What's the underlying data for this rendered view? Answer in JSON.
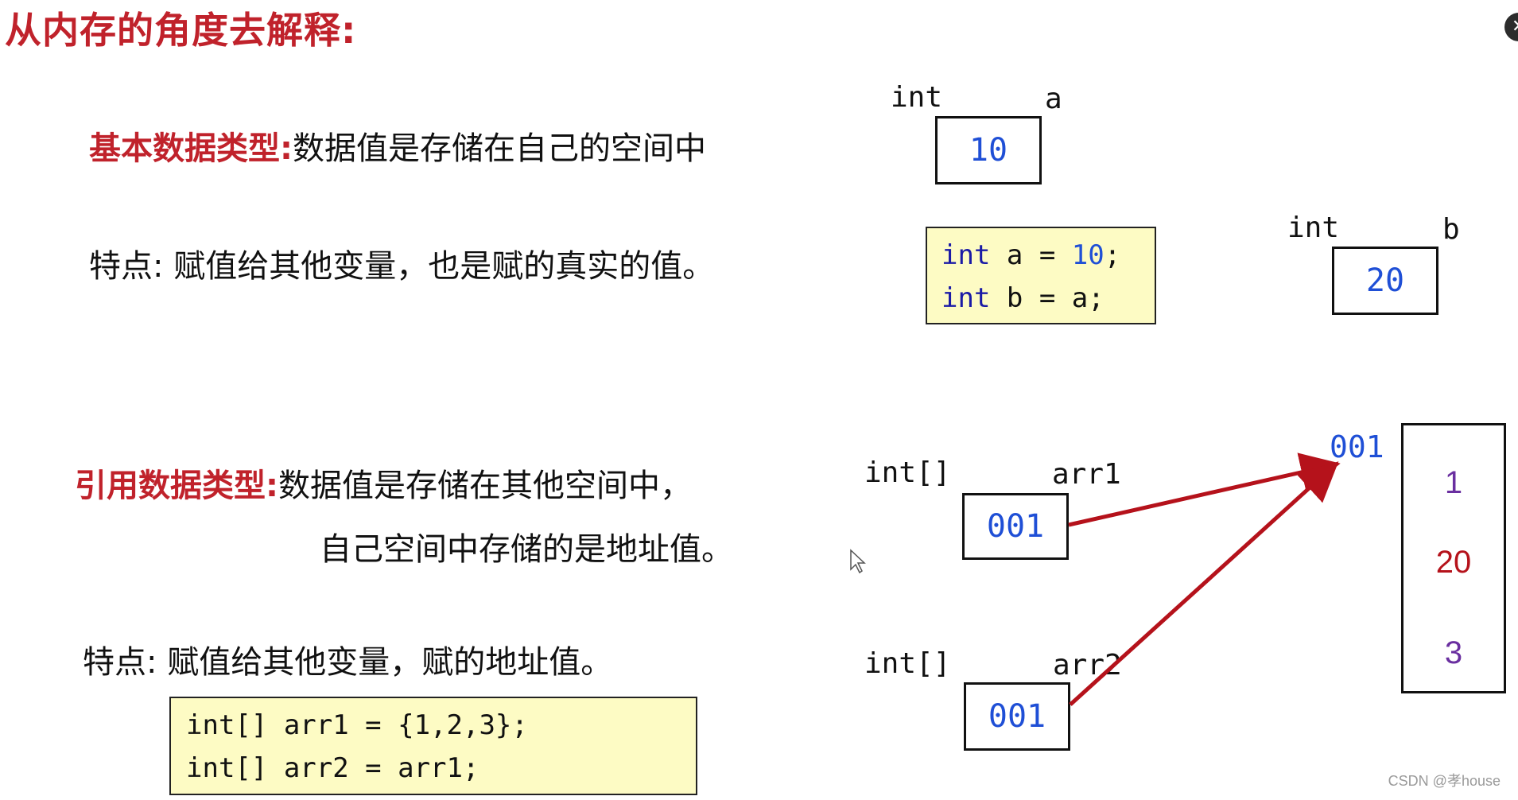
{
  "title": "从内存的角度去解释:",
  "primitive": {
    "label": "基本数据类型:",
    "description": "数据值是存储在自己的空间中",
    "feature": "特点: 赋值给其他变量，也是赋的真实的值。",
    "var_a": {
      "type": "int",
      "name": "a",
      "value": "10"
    },
    "var_b": {
      "type": "int",
      "name": "b",
      "value": "20"
    },
    "code": {
      "line1": {
        "kw": "int",
        "rest1": " a = ",
        "num": "10",
        "rest2": ";"
      },
      "line2": {
        "kw": "int",
        "rest": " b = a;"
      }
    }
  },
  "reference": {
    "label": "引用数据类型:",
    "description_line1": "数据值是存储在其他空间中，",
    "description_line2": "自己空间中存储的是地址值。",
    "feature": "特点: 赋值给其他变量，赋的地址值。",
    "arr1": {
      "type": "int[]",
      "name": "arr1",
      "value": "001"
    },
    "arr2": {
      "type": "int[]",
      "name": "arr2",
      "value": "001"
    },
    "heap": {
      "address": "001",
      "values": [
        "1",
        "20",
        "3"
      ]
    },
    "code": {
      "line1": "int[] arr1 = {1,2,3};",
      "line2": "int[] arr2 = arr1;"
    }
  },
  "colors": {
    "title_red": "#c0222b",
    "arrow_red": "#b5121b",
    "value_blue": "#1f4fd6",
    "heap_purple": "#6a2fa0",
    "heap_red": "#b5121b",
    "code_bg": "#fdfbc4"
  },
  "watermark": "CSDN @孝house",
  "close_icon": "close-icon"
}
